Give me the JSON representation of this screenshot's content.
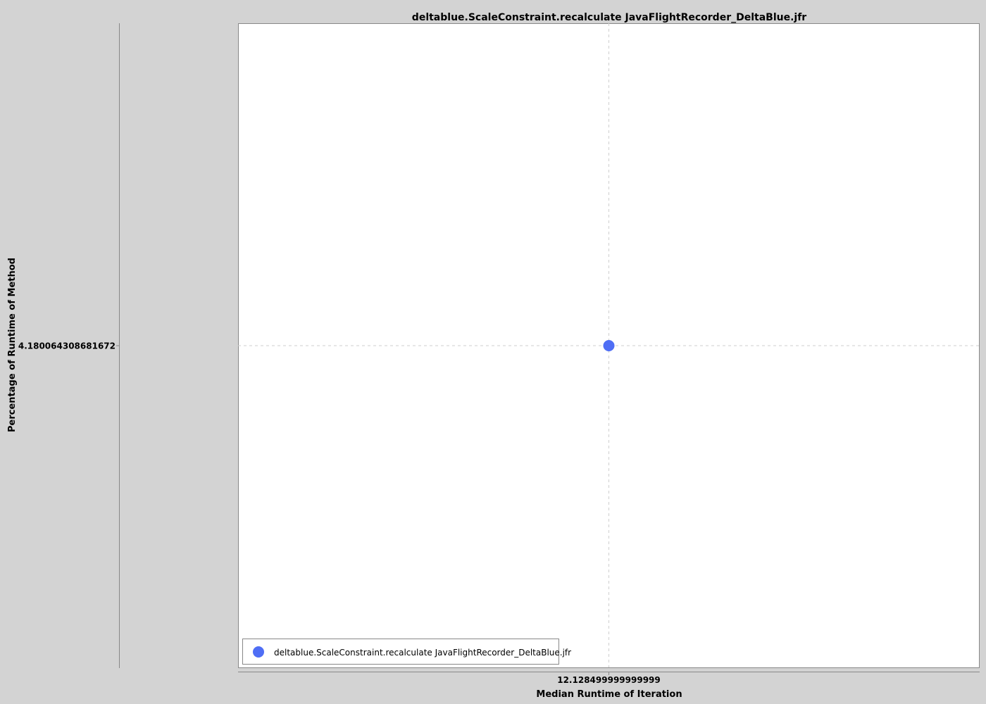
{
  "chart_data": {
    "type": "scatter",
    "title": "deltablue.ScaleConstraint.recalculate JavaFlightRecorder_DeltaBlue.jfr",
    "xlabel": "Median Runtime of Iteration",
    "ylabel": "Percentage of Runtime of Method",
    "x_ticks": [
      "12.128499999999999"
    ],
    "y_ticks": [
      "4.180064308681672"
    ],
    "series": [
      {
        "name": "deltablue.ScaleConstraint.recalculate JavaFlightRecorder_DeltaBlue.jfr",
        "color": "#4f6ef5",
        "points": [
          {
            "x": 12.128499999999999,
            "y": 4.180064308681672
          }
        ]
      }
    ],
    "grid": true,
    "legend_position": "bottom-left",
    "background_color": "#d3d3d3",
    "plot_background_color": "#ffffff"
  }
}
